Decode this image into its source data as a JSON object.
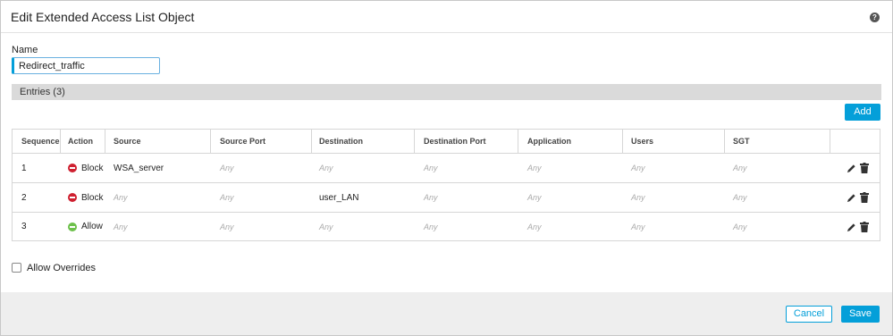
{
  "dialog": {
    "title": "Edit Extended Access List Object",
    "help_icon": "?"
  },
  "name": {
    "label": "Name",
    "value": "Redirect_traffic"
  },
  "entries": {
    "label": "Entries (3)"
  },
  "add_label": "Add",
  "table": {
    "columns": [
      "Sequence",
      "Action",
      "Source",
      "Source Port",
      "Destination",
      "Destination Port",
      "Application",
      "Users",
      "SGT"
    ],
    "rows": [
      {
        "sequence": "1",
        "action": "Block",
        "action_icon": "block-icon",
        "source": "WSA_server",
        "source_port": "Any",
        "destination": "Any",
        "destination_port": "Any",
        "application": "Any",
        "users": "Any",
        "sgt": "Any"
      },
      {
        "sequence": "2",
        "action": "Block",
        "action_icon": "block-icon",
        "source": "Any",
        "source_port": "Any",
        "destination": "user_LAN",
        "destination_port": "Any",
        "application": "Any",
        "users": "Any",
        "sgt": "Any"
      },
      {
        "sequence": "3",
        "action": "Allow",
        "action_icon": "allow-icon",
        "source": "Any",
        "source_port": "Any",
        "destination": "Any",
        "destination_port": "Any",
        "application": "Any",
        "users": "Any",
        "sgt": "Any"
      }
    ],
    "row_icons": [
      "edit-icon",
      "trash-icon"
    ]
  },
  "allow_overrides": {
    "label": "Allow Overrides",
    "checked": false
  },
  "footer": {
    "cancel_label": "Cancel",
    "save_label": "Save"
  },
  "colors": {
    "accent": "#049fd9",
    "block": "#cf2030",
    "allow": "#6cc04a",
    "entries_bar": "#dadada",
    "footer_bg": "#eeeeee"
  }
}
